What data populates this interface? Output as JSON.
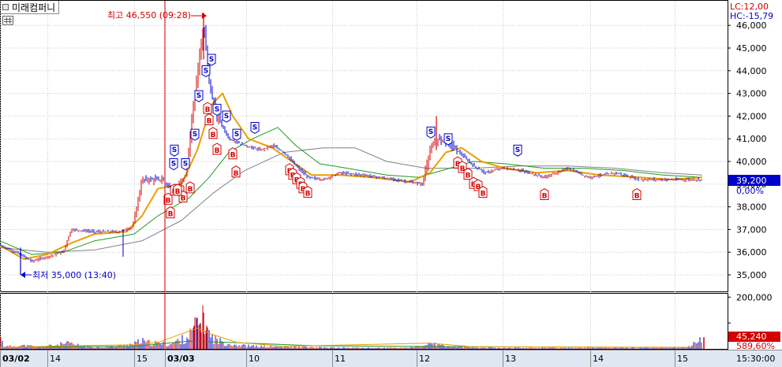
{
  "stock_name": "미래컴퍼니",
  "lc_label": "LC:12,00",
  "hc_label": "HC:-15,79",
  "current_price_label": "39,200",
  "current_change_label": "0,00%",
  "volume_label": "45,240",
  "volume_ratio_label": "589,60%",
  "max_annotation": "최고 46,550 (09:28)",
  "min_annotation": "최저 35,000 (13:40)",
  "colors": {
    "candle_up": "#d40000",
    "candle_down": "#0000cc",
    "ma_short": "#e8a000",
    "ma_mid": "#1e9a1e",
    "ma_long": "#808080",
    "signal_buy": "#d40000",
    "signal_sell": "#0000cc",
    "price_tag_bg": "#0000cc",
    "volume_tag_bg": "#d40000",
    "cursor_line": "#d40000"
  },
  "chart_data": [
    {
      "type": "candlestick",
      "ylim": [
        34500,
        47000
      ],
      "y_ticks": [
        "35,000",
        "36,000",
        "37,000",
        "38,000",
        "39,000",
        "40,000",
        "41,000",
        "42,000",
        "43,000",
        "44,000",
        "45,000",
        "46,000"
      ],
      "x_ticks": [
        "03/02",
        "14",
        "15",
        "03/03",
        "10",
        "11",
        "12",
        "13",
        "14",
        "15"
      ],
      "time_label": "15:30:00",
      "max": {
        "value": 46550,
        "time": "09:28"
      },
      "min": {
        "value": 35000,
        "time": "13:40"
      },
      "last_price": 39200,
      "close_path": [
        {
          "x": 0,
          "y": 36300
        },
        {
          "x": 20,
          "y": 36000
        },
        {
          "x": 40,
          "y": 35600
        },
        {
          "x": 60,
          "y": 35800
        },
        {
          "x": 80,
          "y": 36000
        },
        {
          "x": 90,
          "y": 37000
        },
        {
          "x": 120,
          "y": 36900
        },
        {
          "x": 150,
          "y": 36900
        },
        {
          "x": 168,
          "y": 37100
        },
        {
          "x": 180,
          "y": 39200
        },
        {
          "x": 205,
          "y": 39200
        },
        {
          "x": 220,
          "y": 38700
        },
        {
          "x": 235,
          "y": 39300
        },
        {
          "x": 245,
          "y": 42500
        },
        {
          "x": 252,
          "y": 44500
        },
        {
          "x": 258,
          "y": 46000
        },
        {
          "x": 265,
          "y": 43500
        },
        {
          "x": 275,
          "y": 42000
        },
        {
          "x": 290,
          "y": 41000
        },
        {
          "x": 310,
          "y": 40700
        },
        {
          "x": 330,
          "y": 40500
        },
        {
          "x": 345,
          "y": 40700
        },
        {
          "x": 360,
          "y": 40400
        },
        {
          "x": 375,
          "y": 39800
        },
        {
          "x": 390,
          "y": 39300
        },
        {
          "x": 410,
          "y": 39200
        },
        {
          "x": 430,
          "y": 39500
        },
        {
          "x": 460,
          "y": 39400
        },
        {
          "x": 500,
          "y": 39200
        },
        {
          "x": 535,
          "y": 39000
        },
        {
          "x": 545,
          "y": 40500
        },
        {
          "x": 555,
          "y": 41000
        },
        {
          "x": 570,
          "y": 40800
        },
        {
          "x": 585,
          "y": 40300
        },
        {
          "x": 600,
          "y": 39800
        },
        {
          "x": 615,
          "y": 39500
        },
        {
          "x": 635,
          "y": 39700
        },
        {
          "x": 660,
          "y": 39600
        },
        {
          "x": 690,
          "y": 39300
        },
        {
          "x": 720,
          "y": 39700
        },
        {
          "x": 745,
          "y": 39300
        },
        {
          "x": 780,
          "y": 39500
        },
        {
          "x": 810,
          "y": 39200
        },
        {
          "x": 850,
          "y": 39200
        },
        {
          "x": 890,
          "y": 39200
        }
      ],
      "ma_short": [
        {
          "x": 0,
          "y": 36300
        },
        {
          "x": 30,
          "y": 35700
        },
        {
          "x": 60,
          "y": 35900
        },
        {
          "x": 90,
          "y": 36400
        },
        {
          "x": 120,
          "y": 36800
        },
        {
          "x": 160,
          "y": 36900
        },
        {
          "x": 180,
          "y": 37600
        },
        {
          "x": 200,
          "y": 38800
        },
        {
          "x": 230,
          "y": 39000
        },
        {
          "x": 250,
          "y": 40500
        },
        {
          "x": 268,
          "y": 42500
        },
        {
          "x": 282,
          "y": 43000
        },
        {
          "x": 295,
          "y": 42000
        },
        {
          "x": 315,
          "y": 41000
        },
        {
          "x": 345,
          "y": 40600
        },
        {
          "x": 370,
          "y": 40000
        },
        {
          "x": 395,
          "y": 39400
        },
        {
          "x": 430,
          "y": 39400
        },
        {
          "x": 470,
          "y": 39300
        },
        {
          "x": 520,
          "y": 39100
        },
        {
          "x": 545,
          "y": 39500
        },
        {
          "x": 565,
          "y": 40400
        },
        {
          "x": 585,
          "y": 40600
        },
        {
          "x": 610,
          "y": 40000
        },
        {
          "x": 640,
          "y": 39700
        },
        {
          "x": 680,
          "y": 39500
        },
        {
          "x": 720,
          "y": 39600
        },
        {
          "x": 760,
          "y": 39400
        },
        {
          "x": 810,
          "y": 39300
        },
        {
          "x": 850,
          "y": 39200
        },
        {
          "x": 890,
          "y": 39300
        }
      ],
      "ma_mid": [
        {
          "x": 0,
          "y": 36500
        },
        {
          "x": 40,
          "y": 35900
        },
        {
          "x": 80,
          "y": 36000
        },
        {
          "x": 120,
          "y": 36500
        },
        {
          "x": 170,
          "y": 36800
        },
        {
          "x": 200,
          "y": 37600
        },
        {
          "x": 240,
          "y": 38400
        },
        {
          "x": 265,
          "y": 39300
        },
        {
          "x": 290,
          "y": 40400
        },
        {
          "x": 320,
          "y": 41000
        },
        {
          "x": 352,
          "y": 41500
        },
        {
          "x": 375,
          "y": 40700
        },
        {
          "x": 405,
          "y": 39900
        },
        {
          "x": 440,
          "y": 39700
        },
        {
          "x": 490,
          "y": 39400
        },
        {
          "x": 530,
          "y": 39300
        },
        {
          "x": 560,
          "y": 39600
        },
        {
          "x": 600,
          "y": 40000
        },
        {
          "x": 640,
          "y": 39900
        },
        {
          "x": 690,
          "y": 39700
        },
        {
          "x": 740,
          "y": 39700
        },
        {
          "x": 790,
          "y": 39600
        },
        {
          "x": 840,
          "y": 39400
        },
        {
          "x": 890,
          "y": 39300
        }
      ],
      "ma_long": [
        {
          "x": 0,
          "y": 36200
        },
        {
          "x": 60,
          "y": 36000
        },
        {
          "x": 120,
          "y": 36100
        },
        {
          "x": 180,
          "y": 36500
        },
        {
          "x": 230,
          "y": 37400
        },
        {
          "x": 270,
          "y": 38600
        },
        {
          "x": 310,
          "y": 39600
        },
        {
          "x": 360,
          "y": 40400
        },
        {
          "x": 410,
          "y": 40600
        },
        {
          "x": 450,
          "y": 40600
        },
        {
          "x": 490,
          "y": 40000
        },
        {
          "x": 540,
          "y": 39700
        },
        {
          "x": 600,
          "y": 39700
        },
        {
          "x": 660,
          "y": 39800
        },
        {
          "x": 720,
          "y": 39800
        },
        {
          "x": 780,
          "y": 39700
        },
        {
          "x": 840,
          "y": 39500
        },
        {
          "x": 890,
          "y": 39400
        }
      ],
      "signals": {
        "sell": [
          {
            "x": 221,
            "y": 40200
          },
          {
            "x": 235,
            "y": 39600
          },
          {
            "x": 220,
            "y": 39600
          },
          {
            "x": 247,
            "y": 40900
          },
          {
            "x": 252,
            "y": 42600
          },
          {
            "x": 261,
            "y": 43700
          },
          {
            "x": 268,
            "y": 44200
          },
          {
            "x": 275,
            "y": 42000
          },
          {
            "x": 287,
            "y": 41700
          },
          {
            "x": 300,
            "y": 40900
          },
          {
            "x": 323,
            "y": 41200
          },
          {
            "x": 546,
            "y": 41000
          },
          {
            "x": 568,
            "y": 40700
          },
          {
            "x": 656,
            "y": 40200
          }
        ],
        "buy": [
          {
            "x": 213,
            "y": 38600
          },
          {
            "x": 216,
            "y": 38000
          },
          {
            "x": 221,
            "y": 39000
          },
          {
            "x": 228,
            "y": 39000
          },
          {
            "x": 232,
            "y": 38700
          },
          {
            "x": 241,
            "y": 39100
          },
          {
            "x": 225,
            "y": 39000
          },
          {
            "x": 263,
            "y": 42600
          },
          {
            "x": 265,
            "y": 42100
          },
          {
            "x": 270,
            "y": 41500
          },
          {
            "x": 275,
            "y": 40800
          },
          {
            "x": 295,
            "y": 40600
          },
          {
            "x": 299,
            "y": 39800
          },
          {
            "x": 367,
            "y": 39900
          },
          {
            "x": 371,
            "y": 39700
          },
          {
            "x": 376,
            "y": 39500
          },
          {
            "x": 381,
            "y": 39300
          },
          {
            "x": 384,
            "y": 39100
          },
          {
            "x": 390,
            "y": 38900
          },
          {
            "x": 580,
            "y": 40200
          },
          {
            "x": 586,
            "y": 40000
          },
          {
            "x": 593,
            "y": 39700
          },
          {
            "x": 600,
            "y": 39300
          },
          {
            "x": 606,
            "y": 39200
          },
          {
            "x": 612,
            "y": 38900
          },
          {
            "x": 690,
            "y": 38800
          },
          {
            "x": 807,
            "y": 38800
          }
        ]
      }
    },
    {
      "type": "bar",
      "title": "volume",
      "y_ticks": [
        "200,000",
        "100,000"
      ],
      "ylim": [
        0,
        210000
      ],
      "last_volume": 45240,
      "volume_ratio": "589,60%",
      "volume_ma_short": [
        {
          "x": 0,
          "y": 5000
        },
        {
          "x": 90,
          "y": 12000
        },
        {
          "x": 170,
          "y": 16000
        },
        {
          "x": 200,
          "y": 25000
        },
        {
          "x": 250,
          "y": 80000
        },
        {
          "x": 265,
          "y": 60000
        },
        {
          "x": 300,
          "y": 25000
        },
        {
          "x": 360,
          "y": 10000
        },
        {
          "x": 545,
          "y": 22000
        },
        {
          "x": 600,
          "y": 8000
        },
        {
          "x": 890,
          "y": 6000
        }
      ],
      "volume_ma_long": [
        {
          "x": 0,
          "y": 6000
        },
        {
          "x": 170,
          "y": 10000
        },
        {
          "x": 240,
          "y": 30000
        },
        {
          "x": 290,
          "y": 25000
        },
        {
          "x": 400,
          "y": 12000
        },
        {
          "x": 550,
          "y": 9000
        },
        {
          "x": 890,
          "y": 5000
        }
      ],
      "volume_bars": [
        {
          "x": 5,
          "v": 9000
        },
        {
          "x": 25,
          "v": 15000
        },
        {
          "x": 40,
          "v": 12000
        },
        {
          "x": 50,
          "v": 8000
        },
        {
          "x": 88,
          "v": 25000
        },
        {
          "x": 95,
          "v": 18000
        },
        {
          "x": 110,
          "v": 10000
        },
        {
          "x": 130,
          "v": 8000
        },
        {
          "x": 150,
          "v": 12000
        },
        {
          "x": 170,
          "v": 22000
        },
        {
          "x": 175,
          "v": 30000
        },
        {
          "x": 180,
          "v": 35000
        },
        {
          "x": 185,
          "v": 28000
        },
        {
          "x": 200,
          "v": 25000
        },
        {
          "x": 215,
          "v": 20000
        },
        {
          "x": 225,
          "v": 35000
        },
        {
          "x": 230,
          "v": 40000
        },
        {
          "x": 240,
          "v": 60000
        },
        {
          "x": 246,
          "v": 90000
        },
        {
          "x": 250,
          "v": 120000
        },
        {
          "x": 254,
          "v": 100000
        },
        {
          "x": 258,
          "v": 140000
        },
        {
          "x": 262,
          "v": 90000
        },
        {
          "x": 266,
          "v": 60000
        },
        {
          "x": 270,
          "v": 50000
        },
        {
          "x": 275,
          "v": 40000
        },
        {
          "x": 282,
          "v": 30000
        },
        {
          "x": 290,
          "v": 25000
        },
        {
          "x": 300,
          "v": 18000
        },
        {
          "x": 320,
          "v": 12000
        },
        {
          "x": 345,
          "v": 10000
        },
        {
          "x": 380,
          "v": 8000
        },
        {
          "x": 410,
          "v": 6000
        },
        {
          "x": 460,
          "v": 5000
        },
        {
          "x": 510,
          "v": 5000
        },
        {
          "x": 540,
          "v": 12000
        },
        {
          "x": 546,
          "v": 35000
        },
        {
          "x": 550,
          "v": 22000
        },
        {
          "x": 556,
          "v": 15000
        },
        {
          "x": 570,
          "v": 10000
        },
        {
          "x": 600,
          "v": 6000
        },
        {
          "x": 650,
          "v": 5000
        },
        {
          "x": 700,
          "v": 4000
        },
        {
          "x": 760,
          "v": 4000
        },
        {
          "x": 820,
          "v": 4000
        },
        {
          "x": 870,
          "v": 4000
        },
        {
          "x": 892,
          "v": 45240
        }
      ]
    }
  ]
}
